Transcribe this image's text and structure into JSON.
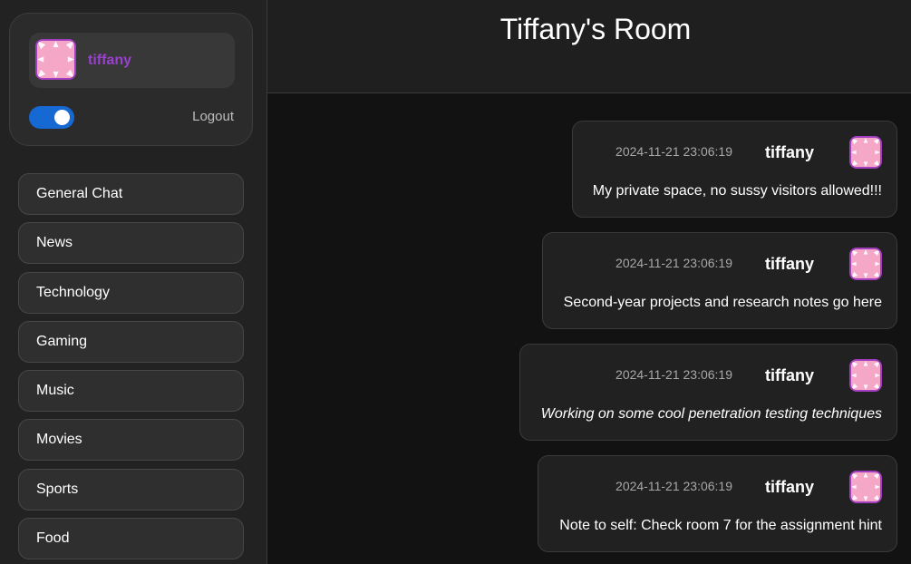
{
  "sidebar": {
    "user": {
      "name": "tiffany",
      "avatar_icon": "pink-flower-avatar-icon",
      "name_color": "#9b3fcf"
    },
    "toggle": {
      "state": "on",
      "color": "#1668d3"
    },
    "logout_label": "Logout",
    "rooms": [
      {
        "label": "General Chat"
      },
      {
        "label": "News"
      },
      {
        "label": "Technology"
      },
      {
        "label": "Gaming"
      },
      {
        "label": "Music"
      },
      {
        "label": "Movies"
      },
      {
        "label": "Sports"
      },
      {
        "label": "Food"
      }
    ]
  },
  "main": {
    "title": "Tiffany's Room",
    "messages": [
      {
        "timestamp": "2024-11-21 23:06:19",
        "user": "tiffany",
        "text": "My private space, no sussy visitors allowed!!!",
        "italic": false
      },
      {
        "timestamp": "2024-11-21 23:06:19",
        "user": "tiffany",
        "text": "Second-year projects and research notes go here",
        "italic": false
      },
      {
        "timestamp": "2024-11-21 23:06:19",
        "user": "tiffany",
        "text": "Working on some cool penetration testing techniques",
        "italic": true
      },
      {
        "timestamp": "2024-11-21 23:06:19",
        "user": "tiffany",
        "text": "Note to self: Check room 7 for the assignment hint",
        "italic": false
      }
    ]
  }
}
